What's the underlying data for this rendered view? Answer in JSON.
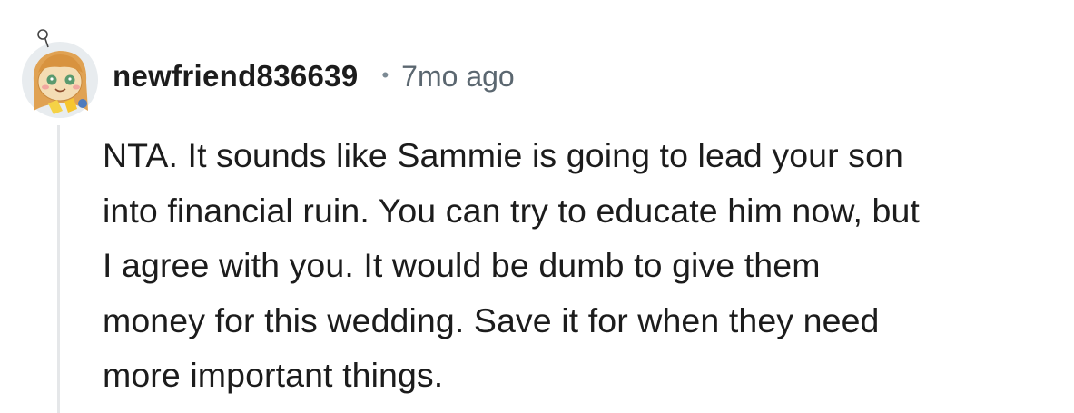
{
  "comment": {
    "author": "newfriend836639",
    "separator": "•",
    "timestamp": "7mo ago",
    "lines": [
      "NTA. It sounds like Sammie is going to lead your son",
      "into financial ruin. You can try to educate him now, but",
      "I agree with you. It would be dumb to give them",
      "money for this wedding. Save it for when they need",
      "more important things."
    ]
  },
  "icons": {
    "avatar": "snoo-avatar-icon"
  },
  "colors": {
    "text": "#1c1c1c",
    "meta": "#5b6770",
    "thread_line": "#e5e7e9"
  }
}
